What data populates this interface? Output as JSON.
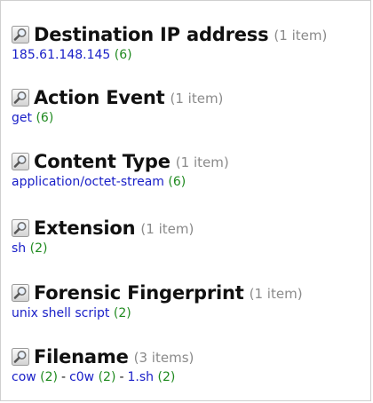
{
  "facets": [
    {
      "title": "Destination IP address",
      "count": "(1 item)",
      "values": [
        {
          "value": "185.61.148.145",
          "count": "(6)"
        }
      ]
    },
    {
      "title": "Action Event",
      "count": "(1 item)",
      "values": [
        {
          "value": "get",
          "count": "(6)"
        }
      ]
    },
    {
      "title": "Content Type",
      "count": "(1 item)",
      "values": [
        {
          "value": "application/octet-stream",
          "count": "(6)"
        }
      ]
    },
    {
      "title": "Extension",
      "count": "(1 item)",
      "values": [
        {
          "value": "sh",
          "count": "(2)"
        }
      ]
    },
    {
      "title": "Forensic Fingerprint",
      "count": "(1 item)",
      "values": [
        {
          "value": "unix shell script",
          "count": "(2)"
        }
      ]
    },
    {
      "title": "Filename",
      "count": "(3 items)",
      "values": [
        {
          "value": "cow",
          "count": "(2)"
        },
        {
          "value": "c0w",
          "count": "(2)"
        },
        {
          "value": "1.sh",
          "count": "(2)"
        }
      ],
      "separator": "-"
    }
  ]
}
